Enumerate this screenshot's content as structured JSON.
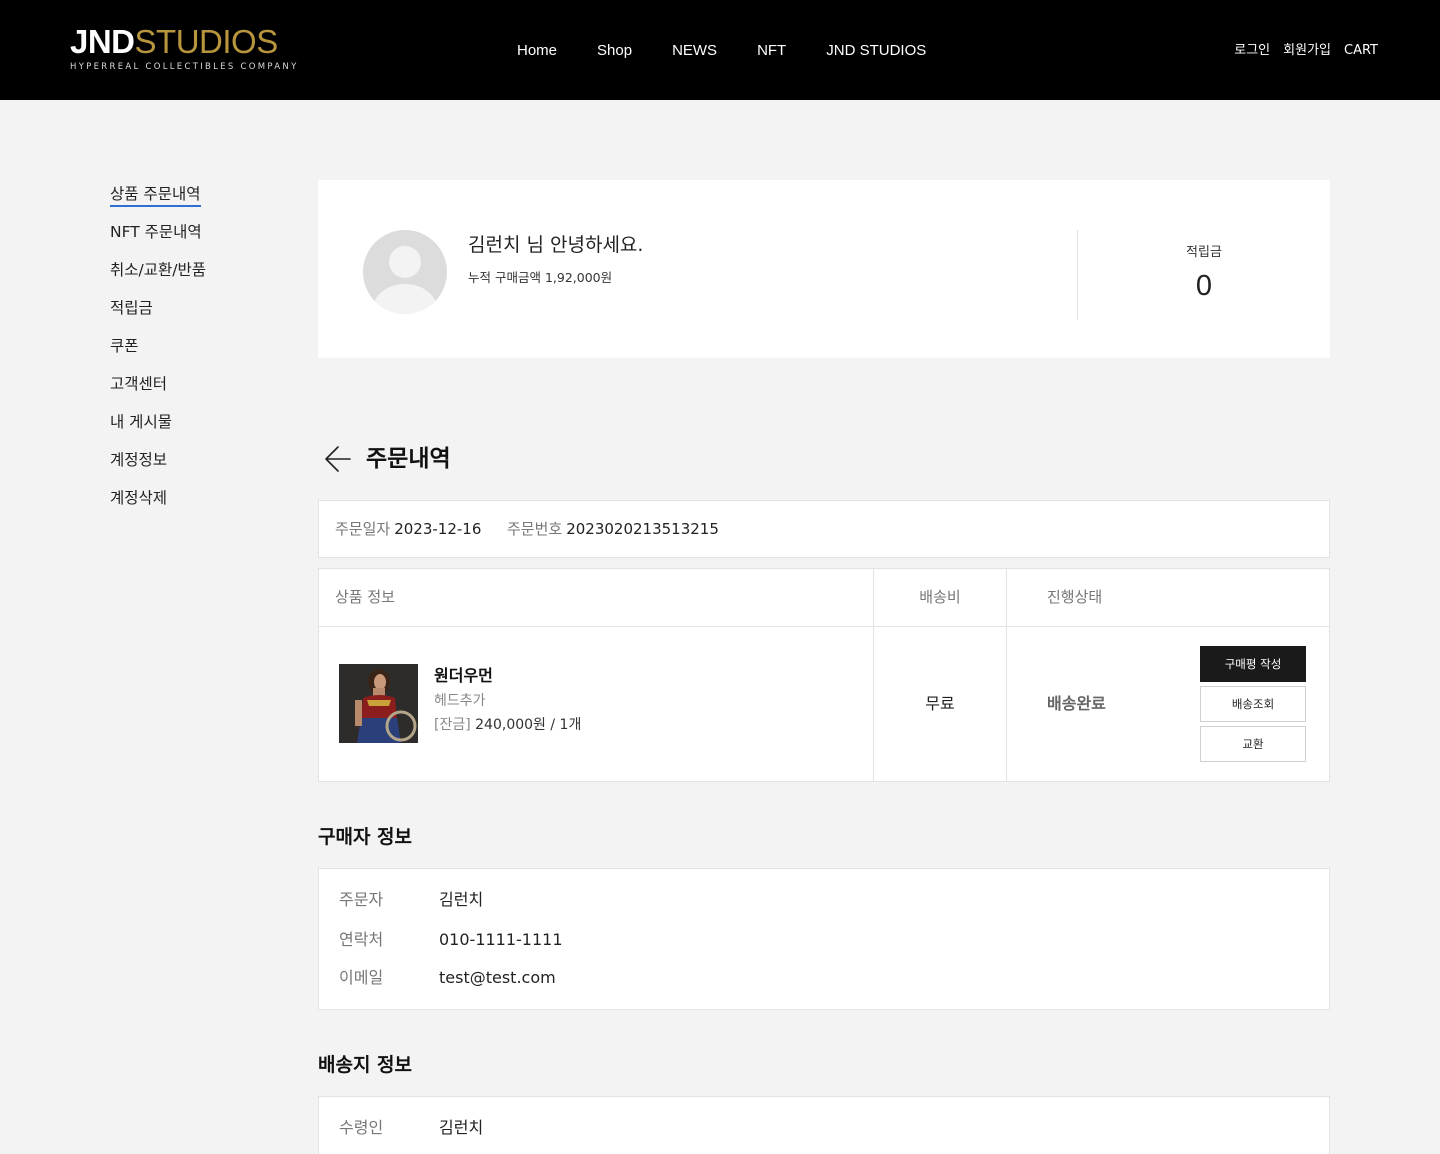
{
  "header": {
    "logo_main": "JND",
    "logo_accent": "STUDIOS",
    "logo_sub": "HYPERREAL COLLECTIBLES COMPANY",
    "nav": [
      "Home",
      "Shop",
      "NEWS",
      "NFT",
      "JND STUDIOS"
    ],
    "util": [
      "로그인",
      "회원가입",
      "CART"
    ]
  },
  "sidebar": {
    "items": [
      "상품 주문내역",
      "NFT 주문내역",
      "취소/교환/반품",
      "적립금",
      "쿠폰",
      "고객센터",
      "내 게시물",
      "계정정보",
      "계정삭제"
    ],
    "active_index": 0,
    "accent_color": "#2f6fd1"
  },
  "profile": {
    "greeting": "김런치 님 안녕하세요.",
    "cumulative_label": "누적 구매금액",
    "cumulative_value": "1,92,000원",
    "points_label": "적립금",
    "points_value": "0"
  },
  "order": {
    "title": "주문내역",
    "back_icon": "arrow-left-icon",
    "date_label": "주문일자",
    "date_value": "2023-12-16",
    "number_label": "주문번호",
    "number_value": "2023020213513215",
    "columns": [
      "상품 정보",
      "배송비",
      "진행상태"
    ],
    "item": {
      "name": "원더우먼",
      "option": "헤드추가",
      "price_tag": "[잔금]",
      "price": "240,000원 / 1개",
      "shipping": "무료",
      "status": "배송완료"
    },
    "buttons": [
      "구매평 작성",
      "배송조회",
      "교환"
    ]
  },
  "buyer": {
    "title": "구매자 정보",
    "rows": [
      {
        "label": "주문자",
        "value": "김런치"
      },
      {
        "label": "연락처",
        "value": "010-1111-1111"
      },
      {
        "label": "이메일",
        "value": "test@test.com"
      }
    ]
  },
  "shipping": {
    "title": "배송지 정보",
    "rows": [
      {
        "label": "수령인",
        "value": "김런치"
      }
    ]
  },
  "colors": {
    "header_bg": "#000000",
    "logo_gold": "#b8963e",
    "page_bg": "#f3f3f3",
    "dark_button": "#1a1a1a"
  }
}
